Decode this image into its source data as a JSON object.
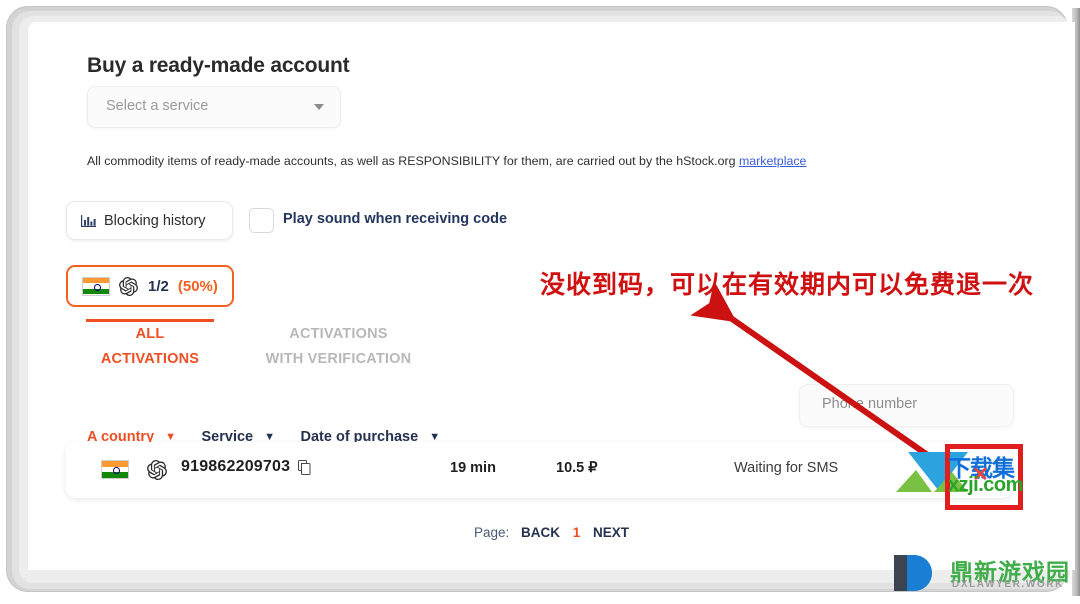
{
  "page": {
    "title": "Buy a ready-made account",
    "service_select": {
      "placeholder": "Select a service",
      "icon": "chevron-down-icon"
    },
    "disclaimer": {
      "text": "All commodity items of ready-made accounts, as well as RESPONSIBILITY for them, are carried out by the hStock.org ",
      "link_text": "marketplace"
    },
    "blocking_history": {
      "label": "Blocking history",
      "icon": "bar-chart-icon"
    },
    "play_sound": {
      "label": "Play sound when receiving code",
      "checked": false
    },
    "badge": {
      "flag": "india-flag-icon",
      "service_icon": "openai-icon",
      "count": "1/2",
      "percent": "(50%)",
      "accent_color": "#f26122"
    },
    "tabs": [
      {
        "label_line1": "ALL",
        "label_line2": "ACTIVATIONS",
        "active": true
      },
      {
        "label_line1": "ACTIVATIONS",
        "label_line2": "WITH VERIFICATION",
        "active": false
      }
    ],
    "filters": [
      {
        "label": "A country",
        "accent": true,
        "icon": "chevron-down-icon"
      },
      {
        "label": "Service",
        "accent": false,
        "icon": "chevron-down-icon"
      },
      {
        "label": "Date of purchase",
        "accent": false,
        "icon": "chevron-down-icon"
      }
    ],
    "phone_search": {
      "placeholder": "Phone number",
      "value": ""
    },
    "table": {
      "rows": [
        {
          "flag": "india-flag-icon",
          "service_icon": "openai-icon",
          "number": "919862209703",
          "copy_icon": "copy-icon",
          "time": "19 min",
          "price": "10.5 ₽",
          "status": "Waiting for SMS"
        }
      ]
    },
    "pagination": {
      "label": "Page:",
      "back": "BACK",
      "current": "1",
      "next": "NEXT"
    }
  },
  "annotations": {
    "note_text": "没收到码，可以在有效期内可以免费退一次",
    "note_color": "#cf1111",
    "arrow_color": "#cc1111"
  },
  "watermarks": {
    "xzji": {
      "top_text": "下载集",
      "bottom_text": "xzji.com",
      "x_mark": "✕",
      "box_color": "#e11d1d",
      "top_color": "#1170d8",
      "bottom_color": "#2aa32a"
    },
    "dxlawyer": {
      "cn_text": "鼎新游戏园",
      "en_text": "DXLAWYER.WORK",
      "cn_color": "#3fae49",
      "en_color": "#9b9b9b"
    }
  }
}
